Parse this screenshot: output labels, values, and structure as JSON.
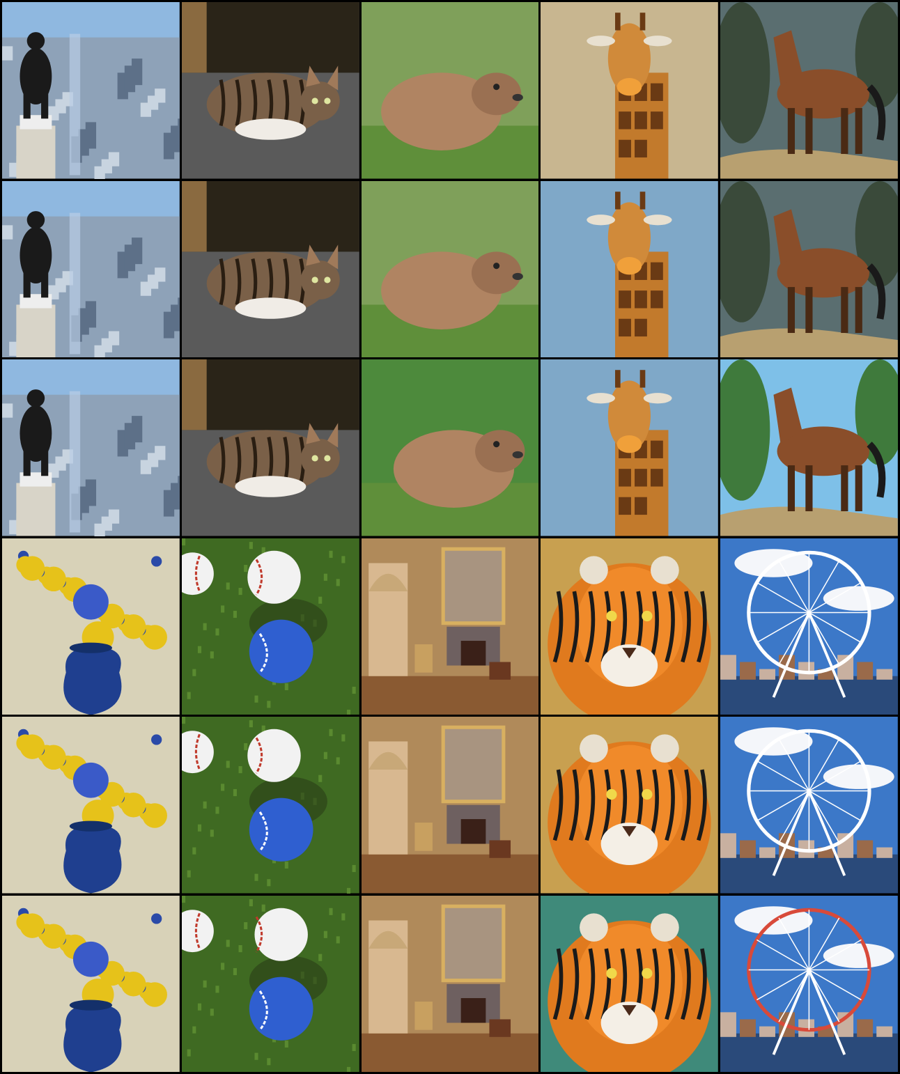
{
  "grid": {
    "rows": 6,
    "columns": 5,
    "cells": [
      {
        "subject": "gorilla-on-skyscraper",
        "style": "photo",
        "row": 1
      },
      {
        "subject": "tabby-cat",
        "style": "photo",
        "row": 1
      },
      {
        "subject": "capybara",
        "style": "photo",
        "row": 1
      },
      {
        "subject": "giraffe",
        "style": "photo",
        "row": 1
      },
      {
        "subject": "horse-on-rock",
        "style": "painting",
        "row": 1
      },
      {
        "subject": "gorilla-on-skyscraper",
        "style": "photo",
        "row": 2
      },
      {
        "subject": "tabby-cat",
        "style": "photo",
        "row": 2
      },
      {
        "subject": "capybara",
        "style": "photo",
        "row": 2
      },
      {
        "subject": "giraffe",
        "style": "painting",
        "row": 2
      },
      {
        "subject": "horse-on-rock",
        "style": "painting",
        "row": 2
      },
      {
        "subject": "gorilla-on-skyscraper",
        "style": "photo",
        "row": 3
      },
      {
        "subject": "tabby-cat",
        "style": "photo",
        "row": 3
      },
      {
        "subject": "capybara",
        "style": "illustration",
        "row": 3
      },
      {
        "subject": "giraffe",
        "style": "illustration",
        "row": 3
      },
      {
        "subject": "horse-on-rock",
        "style": "illustration",
        "row": 3
      },
      {
        "subject": "flowers-in-blue-vase",
        "style": "painting",
        "row": 4
      },
      {
        "subject": "baseballs-on-grass",
        "style": "photo",
        "row": 4
      },
      {
        "subject": "ornate-room",
        "style": "painting",
        "row": 4
      },
      {
        "subject": "tiger",
        "style": "painting",
        "row": 4
      },
      {
        "subject": "ferris-wheel",
        "style": "photo",
        "row": 4
      },
      {
        "subject": "flowers-in-blue-vase",
        "style": "painting",
        "row": 5
      },
      {
        "subject": "baseballs-on-grass",
        "style": "photo",
        "row": 5
      },
      {
        "subject": "ornate-room",
        "style": "painting",
        "row": 5
      },
      {
        "subject": "tiger",
        "style": "painting",
        "row": 5
      },
      {
        "subject": "ferris-wheel",
        "style": "painting",
        "row": 5
      },
      {
        "subject": "flowers-in-blue-vase",
        "style": "painting",
        "row": 6
      },
      {
        "subject": "baseballs-on-grass",
        "style": "illustration",
        "row": 6
      },
      {
        "subject": "ornate-room",
        "style": "illustration",
        "row": 6
      },
      {
        "subject": "tiger",
        "style": "illustration",
        "row": 6
      },
      {
        "subject": "ferris-wheel",
        "style": "illustration",
        "row": 6
      }
    ]
  },
  "colors": {
    "sky_blue": "#8fb8e0",
    "city_gray": "#8ea2b8",
    "cat_brown": "#7a6048",
    "capybara": "#b08462",
    "grass_green": "#5f8f3a",
    "giraffe_orange": "#c27a2c",
    "horse_brown": "#8a4e2a",
    "vase_blue": "#1f3f8f",
    "flower_yellow": "#e6c21a",
    "baseball_white": "#f2f2f2",
    "baseball_blue": "#2f5fd0",
    "room_gold": "#b08a5a",
    "tiger_orange": "#e07a1e",
    "wheel_sky": "#3c78c8"
  }
}
